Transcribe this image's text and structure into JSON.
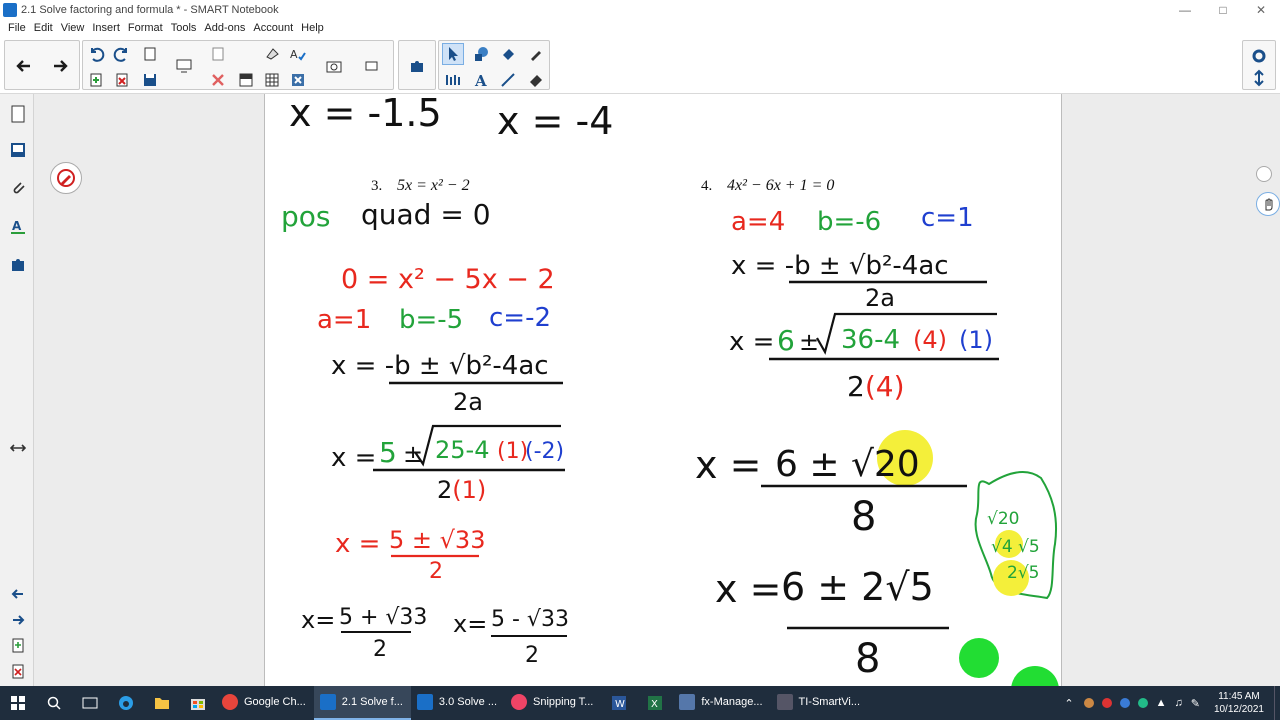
{
  "window": {
    "title": "2.1 Solve factoring and formula * - SMART Notebook"
  },
  "menu": [
    "File",
    "Edit",
    "View",
    "Insert",
    "Format",
    "Tools",
    "Add-ons",
    "Account",
    "Help"
  ],
  "page": {
    "top_left_answer": "x = -1.5",
    "top_right_answer": "x = -4",
    "problem3_label": "3.",
    "problem3_equation": "5x = x² − 2",
    "problem4_label": "4.",
    "problem4_equation": "4x² − 6x + 1 = 0",
    "p3_note_pos": "pos",
    "p3_note_quad": "quad = 0",
    "p3_standard": "0 = x² − 5x − 2",
    "p3_a": "a=1",
    "p3_b": "b=-5",
    "p3_c": "c=-2",
    "p3_formula_num": "x = -b ± √b²-4ac",
    "p3_formula_den": "2a",
    "p3_sub_5": "5",
    "p3_sub_pm": "±",
    "p3_sub_25": "25-4",
    "p3_sub_1": "(1)",
    "p3_sub_m2": "(-2)",
    "p3_sub_den": "2(1)",
    "p3_simpl_num": "5 ± √33",
    "p3_simpl_den": "2",
    "p3_ans1_num": "5 + √33",
    "p3_ans1_den": "2",
    "p3_ans2_num": "5 - √33",
    "p3_ans2_den": "2",
    "p4_a": "a=4",
    "p4_b": "b=-6",
    "p4_c": "c=1",
    "p4_formula_num": "x = -b ± √b²-4ac",
    "p4_formula_den": "2a",
    "p4_sub_6": "6",
    "p4_sub_36": "36-4",
    "p4_sub_4": "(4)",
    "p4_sub_1": "(1)",
    "p4_sub_den": "2(4)",
    "p4_step_num": "6 ± √20",
    "p4_step_den": "8",
    "p4_side_1": "√20",
    "p4_side_2": "√4 √5",
    "p4_side_3": "2√5",
    "p4_final_num": "6 ± 2√5",
    "p4_final_den": "8"
  },
  "taskbar": {
    "apps": [
      "Google Ch...",
      "2.1 Solve f...",
      "3.0 Solve ...",
      "Snipping T...",
      "fx-Manage...",
      "TI-SmartVi..."
    ],
    "time": "11:45 AM",
    "date": "10/12/2021"
  },
  "colors": {
    "red": "#e8281e",
    "green": "#22a33a",
    "blue": "#1f3fcf",
    "highlight": "#f4ef3a",
    "accent": "#1a6fc7"
  }
}
